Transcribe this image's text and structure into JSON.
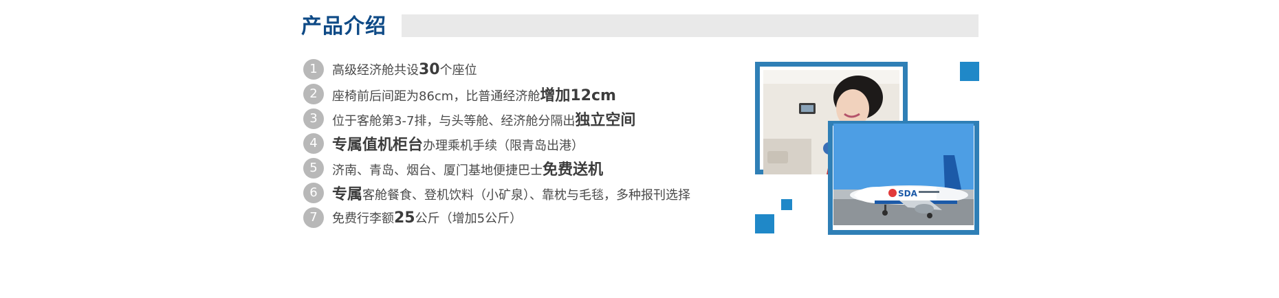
{
  "section": {
    "title": "产品介绍"
  },
  "features": [
    {
      "num": "1",
      "pre": "高级经济舱共设",
      "strong": "30",
      "post": "个座位"
    },
    {
      "num": "2",
      "pre": "座椅前后间距为86cm，比普通经济舱",
      "strong": "增加12cm",
      "post": ""
    },
    {
      "num": "3",
      "pre": "位于客舱第3-7排，与头等舱、经济舱分隔出",
      "strong": "独立空间",
      "post": ""
    },
    {
      "num": "4",
      "pre": "",
      "strong": "专属值机柜台",
      "post": "办理乘机手续（限青岛出港）"
    },
    {
      "num": "5",
      "pre": "济南、青岛、烟台、厦门基地便捷巴士",
      "strong": "免费送机",
      "post": ""
    },
    {
      "num": "6",
      "pre": "",
      "strong": "专属",
      "post": "客舱餐食、登机饮料（小矿泉）、靠枕与毛毯，多种报刊选择"
    },
    {
      "num": "7",
      "pre": "免费行李额",
      "strong": "25",
      "post": "公斤（增加5公斤）"
    }
  ],
  "photos": {
    "top": "flight-attendant-photo",
    "bottom": "airplane-photo",
    "airline_logo_text": "SDA"
  },
  "colors": {
    "title": "#0e4a86",
    "accent_blue": "#1f88c8",
    "frame_blue": "#2f7fb6",
    "bar_gray": "#e9e9e9",
    "badge_gray": "#b8b8b8"
  }
}
